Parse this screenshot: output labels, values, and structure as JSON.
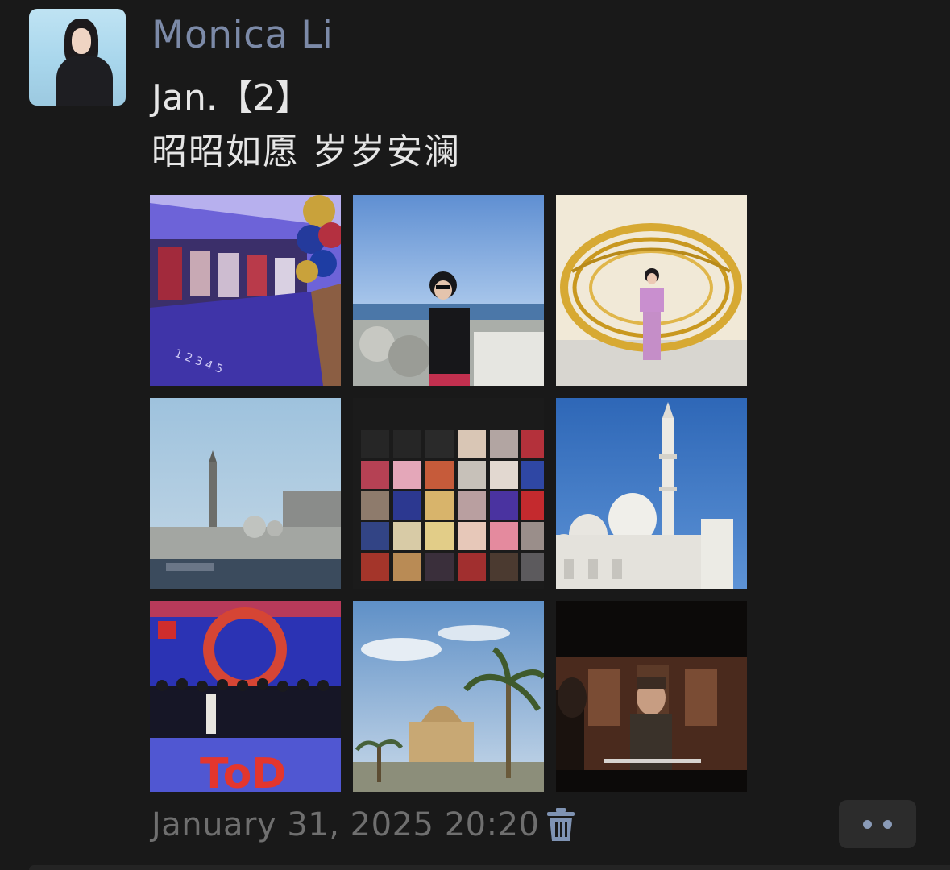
{
  "post": {
    "author": "Monica Li",
    "text_line1": "Jan.【2】",
    "text_line2": "昭昭如愿 岁岁安澜",
    "timestamp": "January 31, 2025 20:20"
  },
  "photos": [
    {
      "label": "photo-1"
    },
    {
      "label": "photo-2"
    },
    {
      "label": "photo-3"
    },
    {
      "label": "photo-4"
    },
    {
      "label": "photo-5"
    },
    {
      "label": "photo-6"
    },
    {
      "label": "photo-7"
    },
    {
      "label": "photo-8"
    },
    {
      "label": "photo-9"
    }
  ],
  "photo_texts": {
    "tod_logo": "ToD",
    "track_numbers": "1 2 3 4 5"
  },
  "icons": {
    "delete": "trash-icon",
    "more": "more-dots-icon"
  },
  "colors": {
    "background": "#191919",
    "author_name": "#7c8aa8",
    "body_text": "#e6e6e6",
    "timestamp": "#6f6f6f",
    "more_button_bg": "#2c2c2c",
    "more_dots": "#8a9bb8"
  }
}
